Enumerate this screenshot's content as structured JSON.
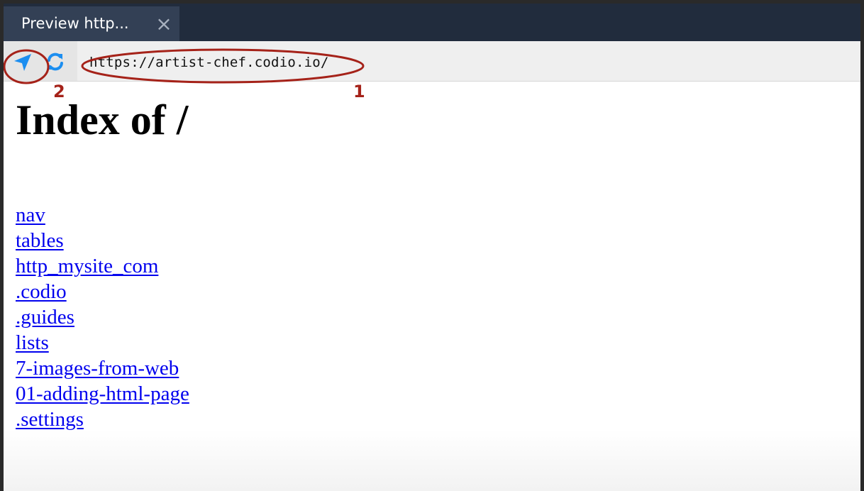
{
  "tab": {
    "label": "Preview http...",
    "close_icon": "close-icon"
  },
  "toolbar": {
    "url": "https://artist-chef.codio.io/",
    "navigate_icon": "location-arrow-icon",
    "refresh_icon": "refresh-icon",
    "icon_color": "#1c8ef0"
  },
  "annotations": {
    "color": "#a52219",
    "label_1": "1",
    "label_2": "2"
  },
  "page": {
    "title": "Index of /",
    "links": [
      "nav",
      "tables",
      "http_mysite_com",
      ".codio",
      ".guides",
      "lists",
      "7-images-from-web",
      "01-adding-html-page",
      ".settings"
    ]
  }
}
